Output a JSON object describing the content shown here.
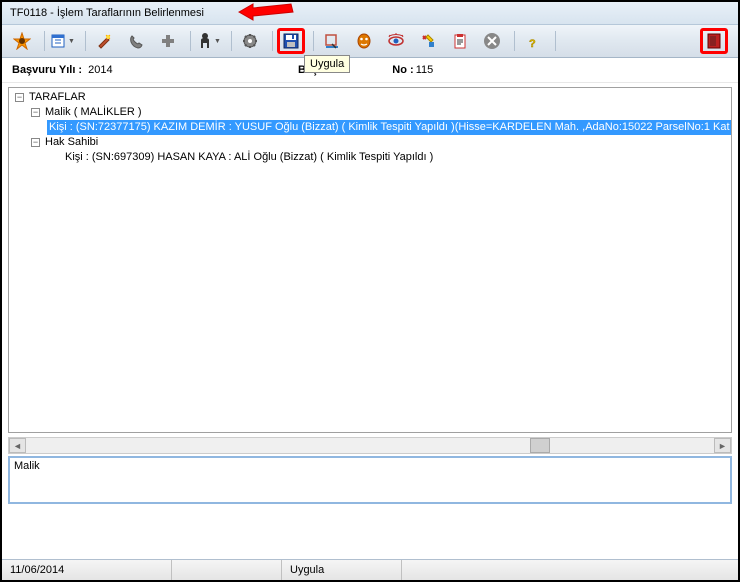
{
  "window": {
    "title": "TF0118 - İşlem Taraflarının Belirlenmesi"
  },
  "toolbar": {
    "save_tooltip": "Uygula",
    "icons": {
      "app": "app-icon",
      "calendar": "calendar-icon",
      "wizard": "wizard-icon",
      "phone": "phone-icon",
      "add": "plus-icon",
      "user": "person-icon",
      "settings": "gear-icon",
      "save": "floppy-icon",
      "inspect": "inspect-icon",
      "mask": "mask-icon",
      "eye": "eye-icon",
      "tools": "tools-icon",
      "clipboard": "clipboard-icon",
      "close": "close-icon",
      "help": "help-icon",
      "exit": "exit-icon"
    }
  },
  "fields": {
    "year_label": "Başvuru Yılı :",
    "year_value": "2014",
    "no_label_partial": "Başvur",
    "no_label_partial2": "No :",
    "no_value": "115"
  },
  "tree": {
    "root": "TARAFLAR",
    "nodes": [
      {
        "label": "Malik ( MALİKLER )",
        "children": [
          "Kişi : (SN:72377175) KAZIM DEMİR : YUSUF Oğlu  (Bizzat) ( Kimlik Tespiti Yapıldı )(Hisse=KARDELEN Mah. ,AdaNo:15022 ParselNo:1 Kat"
        ]
      },
      {
        "label": "Hak Sahibi",
        "children": [
          "Kişi : (SN:697309) HASAN KAYA : ALİ Oğlu  (Bizzat) ( Kimlik Tespiti Yapıldı )"
        ]
      }
    ],
    "expander_minus": "−"
  },
  "description": {
    "value": "Malik"
  },
  "statusbar": {
    "date": "11/06/2014",
    "save_label": "Uygula"
  }
}
